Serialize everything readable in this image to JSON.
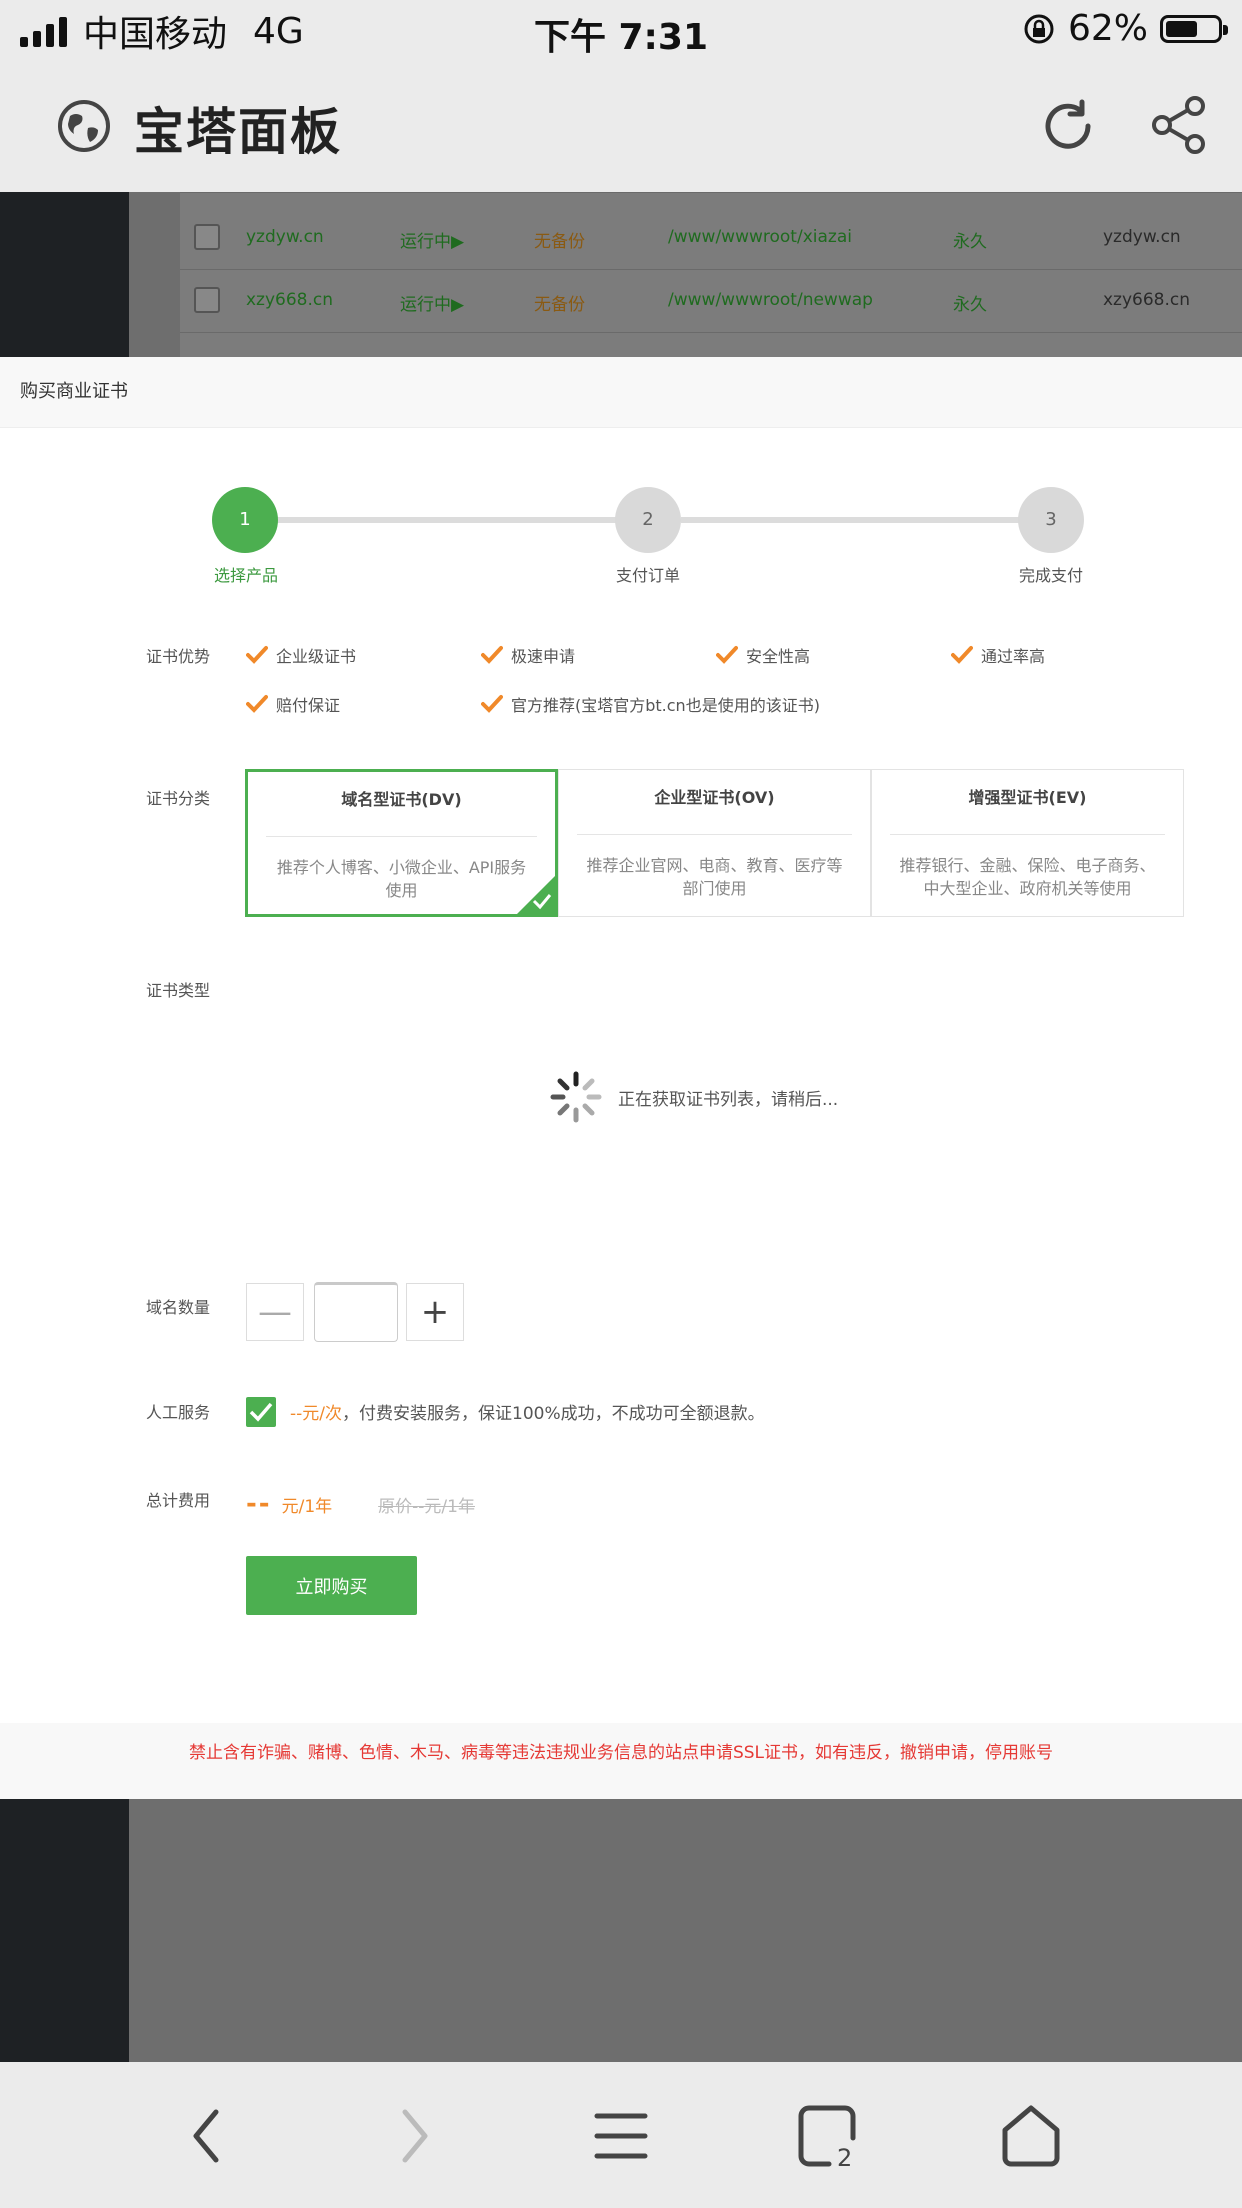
{
  "status_bar": {
    "carrier": "中国移动",
    "network": "4G",
    "time": "下午 7:31",
    "battery": "62%",
    "battery_level": 0.62
  },
  "app_bar": {
    "title": "宝塔面板",
    "icons": [
      "globe-icon",
      "refresh-icon",
      "share-icon"
    ]
  },
  "background_table": {
    "rows": [
      {
        "domain": "yzdyw.cn",
        "status": "运行中▶",
        "backup": "无备份",
        "path": "/www/wwwroot/xiazai",
        "expire": "永久",
        "remark": "yzdyw.cn"
      },
      {
        "domain": "xzy668.cn",
        "status": "运行中▶",
        "backup": "无备份",
        "path": "/www/wwwroot/newwap",
        "expire": "永久",
        "remark": "xzy668.cn"
      }
    ]
  },
  "modal": {
    "title": "购买商业证书",
    "steps": [
      {
        "number": "1",
        "label": "选择产品"
      },
      {
        "number": "2",
        "label": "支付订单"
      },
      {
        "number": "3",
        "label": "完成支付"
      }
    ],
    "labels": {
      "advantages": "证书优势",
      "category": "证书分类",
      "type": "证书类型",
      "domain_count": "域名数量",
      "service": "人工服务",
      "total": "总计费用"
    },
    "advantages": [
      "企业级证书",
      "极速申请",
      "安全性高",
      "通过率高",
      "赔付保证",
      "官方推荐(宝塔官方bt.cn也是使用的该证书)"
    ],
    "categories": [
      {
        "title": "域名型证书(DV)",
        "desc": "推荐个人博客、小微企业、API服务使用"
      },
      {
        "title": "企业型证书(OV)",
        "desc": "推荐企业官网、电商、教育、医疗等部门使用"
      },
      {
        "title": "增强型证书(EV)",
        "desc": "推荐银行、金融、保险、电子商务、中大型企业、政府机关等使用"
      }
    ],
    "loading_text": "正在获取证书列表，请稍后...",
    "stepper": {
      "minus": "—",
      "plus": "+",
      "value": ""
    },
    "service": {
      "price": "--元/次",
      "text": "，付费安装服务，保证100%成功，不成功可全额退款。"
    },
    "total": {
      "price": "--",
      "unit": "元/1年",
      "original": "原价--元/1年"
    },
    "buy_button": "立即购买",
    "footer_notice": "禁止含有诈骗、赌博、色情、木马、病毒等违法违规业务信息的站点申请SSL证书，如有违反，撤销申请，停用账号"
  },
  "colors": {
    "accent_green": "#4caf50",
    "warning_orange": "#f0892a",
    "danger_red": "#e53935"
  },
  "browser_bar": {
    "icons": [
      "back-icon",
      "forward-icon",
      "menu-icon",
      "tabs-icon",
      "home-icon"
    ],
    "tab_count": "2"
  }
}
